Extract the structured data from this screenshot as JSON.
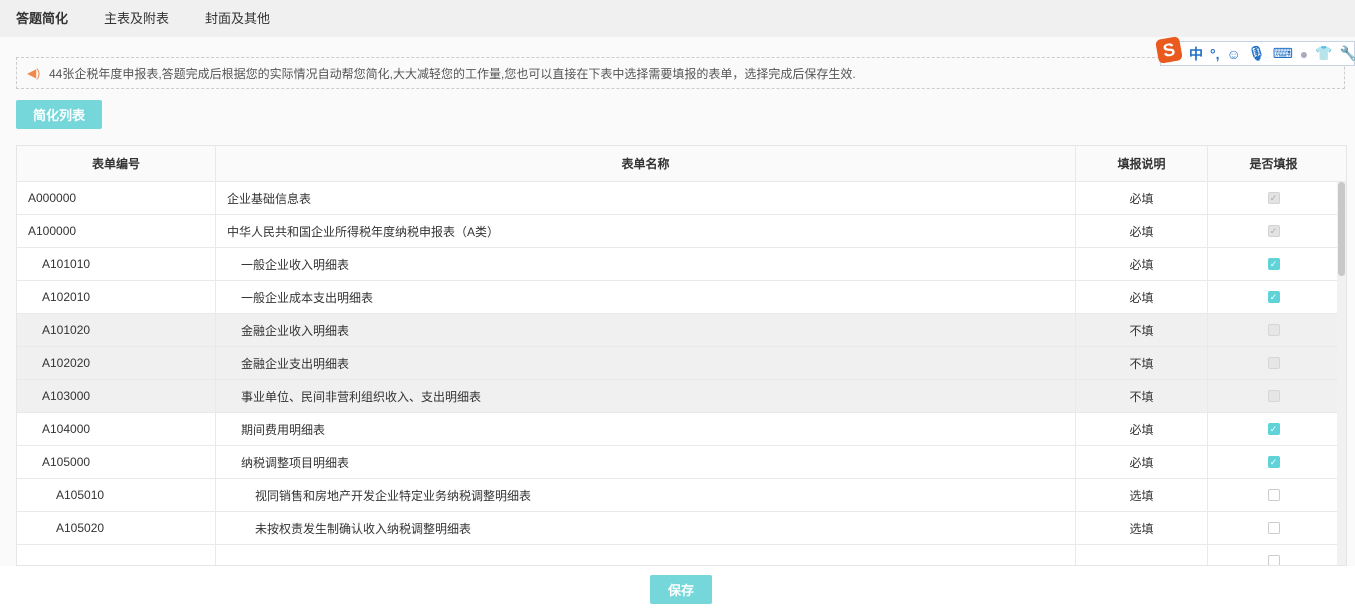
{
  "tabs": [
    "答题简化",
    "主表及附表",
    "封面及其他"
  ],
  "notice": "44张企税年度申报表,答题完成后根据您的实际情况自动帮您简化,大大减轻您的工作量,您也可以直接在下表中选择需要填报的表单，选择完成后保存生效.",
  "simplify_button": "简化列表",
  "columns": [
    "表单编号",
    "表单名称",
    "填报说明",
    "是否填报"
  ],
  "rows": [
    {
      "code": "A000000",
      "name": "企业基础信息表",
      "note": "必填",
      "state": "locked",
      "level": 0,
      "disabled": false
    },
    {
      "code": "A100000",
      "name": "中华人民共和国企业所得税年度纳税申报表（A类）",
      "note": "必填",
      "state": "locked",
      "level": 0,
      "disabled": false
    },
    {
      "code": "A101010",
      "name": "一般企业收入明细表",
      "note": "必填",
      "state": "checked",
      "level": 1,
      "disabled": false
    },
    {
      "code": "A102010",
      "name": "一般企业成本支出明细表",
      "note": "必填",
      "state": "checked",
      "level": 1,
      "disabled": false
    },
    {
      "code": "A101020",
      "name": "金融企业收入明细表",
      "note": "不填",
      "state": "disabled",
      "level": 1,
      "disabled": true
    },
    {
      "code": "A102020",
      "name": "金融企业支出明细表",
      "note": "不填",
      "state": "disabled",
      "level": 1,
      "disabled": true
    },
    {
      "code": "A103000",
      "name": "事业单位、民间非营利组织收入、支出明细表",
      "note": "不填",
      "state": "disabled",
      "level": 1,
      "disabled": true
    },
    {
      "code": "A104000",
      "name": "期间费用明细表",
      "note": "必填",
      "state": "checked",
      "level": 1,
      "disabled": false
    },
    {
      "code": "A105000",
      "name": "纳税调整项目明细表",
      "note": "必填",
      "state": "checked",
      "level": 1,
      "disabled": false
    },
    {
      "code": "A105010",
      "name": "视同销售和房地产开发企业特定业务纳税调整明细表",
      "note": "选填",
      "state": "unchecked",
      "level": 2,
      "disabled": false
    },
    {
      "code": "A105020",
      "name": "未按权责发生制确认收入纳税调整明细表",
      "note": "选填",
      "state": "unchecked",
      "level": 2,
      "disabled": false
    },
    {
      "code": "",
      "name": "",
      "note": "",
      "state": "unchecked",
      "level": 2,
      "disabled": false
    }
  ],
  "save_button": "保存",
  "ime": {
    "lang": "中",
    "punct": "°,"
  },
  "colors": {
    "accent": "#76d7db",
    "check": "#5fd3d8"
  }
}
